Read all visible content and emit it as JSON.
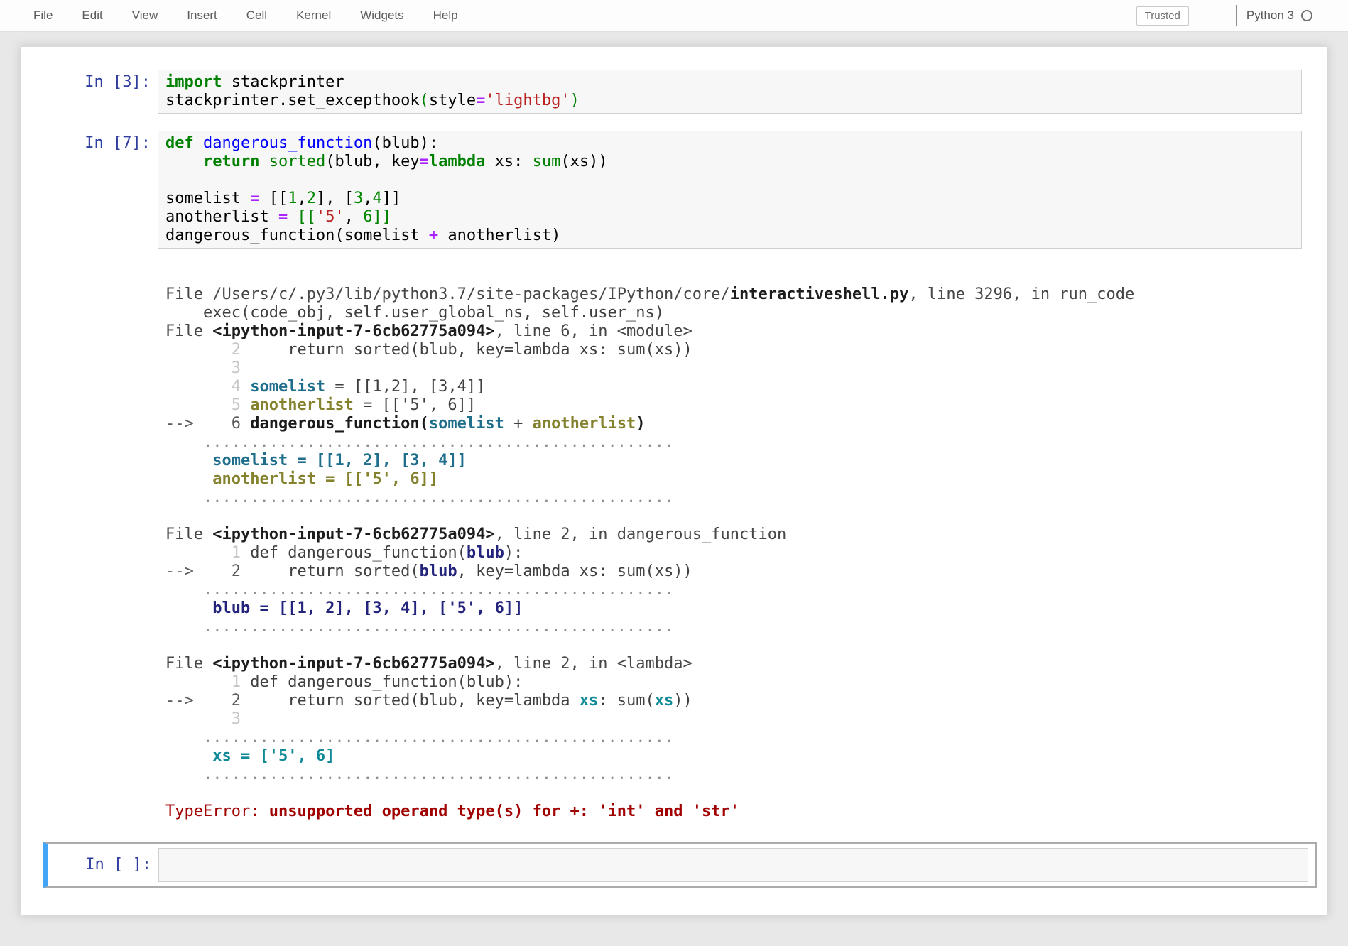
{
  "menu": {
    "items": [
      "File",
      "Edit",
      "View",
      "Insert",
      "Cell",
      "Kernel",
      "Widgets",
      "Help"
    ]
  },
  "header": {
    "trusted_label": "Trusted",
    "kernel_name": "Python 3",
    "kernel_status_icon": "idle-circle-icon"
  },
  "cells": [
    {
      "prompt": "In [3]:",
      "lines": [
        [
          [
            "kw",
            "import"
          ],
          [
            "txt",
            " stackprinter"
          ]
        ],
        [
          [
            "txt",
            "stackprinter.set_excepthook"
          ],
          [
            "grn",
            "("
          ],
          [
            "txt",
            "style"
          ],
          [
            "op",
            "="
          ],
          [
            "str",
            "'lightbg'"
          ],
          [
            "grn",
            ")"
          ]
        ]
      ]
    },
    {
      "prompt": "In [7]:",
      "lines": [
        [
          [
            "kw",
            "def"
          ],
          [
            "txt",
            " "
          ],
          [
            "def",
            "dangerous_function"
          ],
          [
            "txt",
            "(blub):"
          ]
        ],
        [
          [
            "txt",
            "    "
          ],
          [
            "kw",
            "return"
          ],
          [
            "txt",
            " "
          ],
          [
            "bi",
            "sorted"
          ],
          [
            "txt",
            "(blub, key"
          ],
          [
            "op",
            "="
          ],
          [
            "kw",
            "lambda"
          ],
          [
            "txt",
            " xs: "
          ],
          [
            "bi",
            "sum"
          ],
          [
            "txt",
            "(xs))"
          ]
        ],
        [],
        [
          [
            "txt",
            "somelist "
          ],
          [
            "op",
            "="
          ],
          [
            "txt",
            " [["
          ],
          [
            "num",
            "1"
          ],
          [
            "txt",
            ","
          ],
          [
            "num",
            "2"
          ],
          [
            "txt",
            "], ["
          ],
          [
            "num",
            "3"
          ],
          [
            "txt",
            ","
          ],
          [
            "num",
            "4"
          ],
          [
            "txt",
            "]]"
          ]
        ],
        [
          [
            "txt",
            "anotherlist "
          ],
          [
            "op",
            "="
          ],
          [
            "txt",
            " "
          ],
          [
            "grn",
            "[["
          ],
          [
            "str",
            "'5'"
          ],
          [
            "txt",
            ", "
          ],
          [
            "num",
            "6"
          ],
          [
            "grn",
            "]]"
          ]
        ],
        [
          [
            "txt",
            "dangerous_function(somelist "
          ],
          [
            "op",
            "+"
          ],
          [
            "txt",
            " anotherlist)"
          ]
        ]
      ]
    }
  ],
  "output": {
    "lines": [
      [
        [
          "o-h",
          "File /Users/c/.py3/lib/python3.7/site-packages/IPython/core/"
        ],
        [
          "o-hb",
          "interactiveshell.py"
        ],
        [
          "o-h",
          ", line 3296, in run_code"
        ]
      ],
      [
        [
          "o-c",
          "    exec(code_obj, self.user_global_ns, self.user_ns)"
        ]
      ],
      [
        [
          "o-h",
          "File "
        ],
        [
          "o-hb",
          "<ipython-input-7-6cb62775a094>"
        ],
        [
          "o-h",
          ", line 6, in <module>"
        ]
      ],
      [
        [
          "o-ln",
          "       2"
        ],
        [
          "o-c",
          "     return sorted(blub, key=lambda xs: sum(xs))"
        ]
      ],
      [
        [
          "o-ln",
          "       3"
        ]
      ],
      [
        [
          "o-ln",
          "       4"
        ],
        [
          "o-c",
          " "
        ],
        [
          "o-v1",
          "somelist"
        ],
        [
          "o-c",
          " = [[1,2], [3,4]]"
        ]
      ],
      [
        [
          "o-ln",
          "       5"
        ],
        [
          "o-c",
          " "
        ],
        [
          "o-v2",
          "anotherlist"
        ],
        [
          "o-c",
          " = [['5', 6]]"
        ]
      ],
      [
        [
          "o-ar",
          "-->    6"
        ],
        [
          "o-c",
          " "
        ],
        [
          "o-cb",
          "dangerous_function("
        ],
        [
          "o-v1",
          "somelist"
        ],
        [
          "o-c",
          " + "
        ],
        [
          "o-v2",
          "anotherlist"
        ],
        [
          "o-cb",
          ")"
        ]
      ],
      [
        [
          "o-dots",
          "    .................................................."
        ]
      ],
      [
        [
          "o-c",
          "     "
        ],
        [
          "o-v1",
          "somelist = [[1, 2], [3, 4]]"
        ]
      ],
      [
        [
          "o-c",
          "     "
        ],
        [
          "o-v2",
          "anotherlist = [['5', 6]]"
        ]
      ],
      [
        [
          "o-dots",
          "    .................................................."
        ]
      ],
      [],
      [
        [
          "o-h",
          "File "
        ],
        [
          "o-hb",
          "<ipython-input-7-6cb62775a094>"
        ],
        [
          "o-h",
          ", line 2, in dangerous_function"
        ]
      ],
      [
        [
          "o-ln",
          "       1"
        ],
        [
          "o-c",
          " def dangerous_function("
        ],
        [
          "o-v3",
          "blub"
        ],
        [
          "o-c",
          "):"
        ]
      ],
      [
        [
          "o-ar",
          "-->    2"
        ],
        [
          "o-c",
          "     return sorted("
        ],
        [
          "o-v3",
          "blub"
        ],
        [
          "o-c",
          ", key=lambda xs: sum(xs))"
        ]
      ],
      [
        [
          "o-dots",
          "    .................................................."
        ]
      ],
      [
        [
          "o-c",
          "     "
        ],
        [
          "o-v3",
          "blub = [[1, 2], [3, 4], ['5', 6]]"
        ]
      ],
      [
        [
          "o-dots",
          "    .................................................."
        ]
      ],
      [],
      [
        [
          "o-h",
          "File "
        ],
        [
          "o-hb",
          "<ipython-input-7-6cb62775a094>"
        ],
        [
          "o-h",
          ", line 2, in <lambda>"
        ]
      ],
      [
        [
          "o-ln",
          "       1"
        ],
        [
          "o-c",
          " def dangerous_function(blub):"
        ]
      ],
      [
        [
          "o-ar",
          "-->    2"
        ],
        [
          "o-c",
          "     return sorted(blub, key=lambda "
        ],
        [
          "o-v4",
          "xs"
        ],
        [
          "o-c",
          ": sum("
        ],
        [
          "o-v4",
          "xs"
        ],
        [
          "o-c",
          "))"
        ]
      ],
      [
        [
          "o-ln",
          "       3"
        ]
      ],
      [
        [
          "o-dots",
          "    .................................................."
        ]
      ],
      [
        [
          "o-c",
          "     "
        ],
        [
          "o-v4",
          "xs = ['5', 6]"
        ]
      ],
      [
        [
          "o-dots",
          "    .................................................."
        ]
      ],
      [],
      [
        [
          "o-et",
          "TypeError: "
        ],
        [
          "o-em",
          "unsupported operand type(s) for +: 'int' and 'str'"
        ]
      ]
    ]
  },
  "empty_cell": {
    "prompt": "In [ ]:"
  }
}
